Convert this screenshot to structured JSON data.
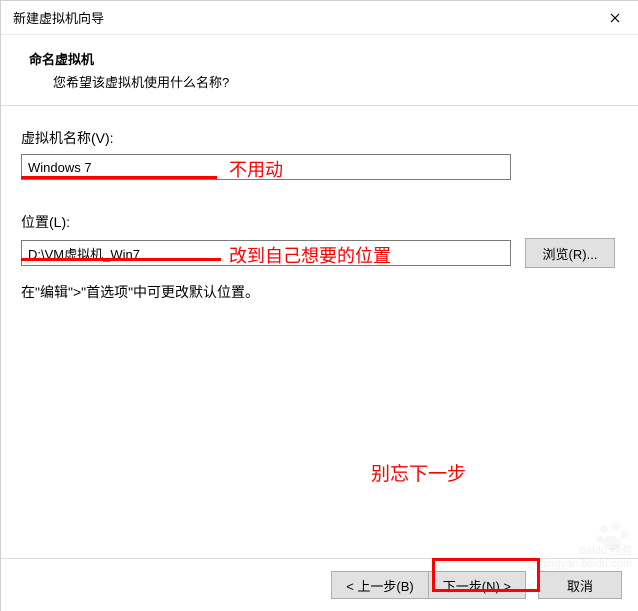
{
  "titlebar": {
    "title": "新建虚拟机向导"
  },
  "header": {
    "title": "命名虚拟机",
    "subtitle": "您希望该虚拟机使用什么名称?"
  },
  "fields": {
    "name_label": "虚拟机名称(V):",
    "name_value": "Windows 7",
    "location_label": "位置(L):",
    "location_value": "D:\\VM虚拟机_Win7",
    "browse_label": "浏览(R)..."
  },
  "hint": "在\"编辑\">\"首选项\"中可更改默认位置。",
  "annotations": {
    "dont_touch": "不用动",
    "change_location": "改到自己想要的位置",
    "dont_forget": "别忘下一步"
  },
  "footer": {
    "back": "< 上一步(B)",
    "next": "下一步(N) >",
    "cancel": "取消"
  },
  "watermark": {
    "brand": "Baidu 经验",
    "url": "jingyan.baidu.com"
  }
}
